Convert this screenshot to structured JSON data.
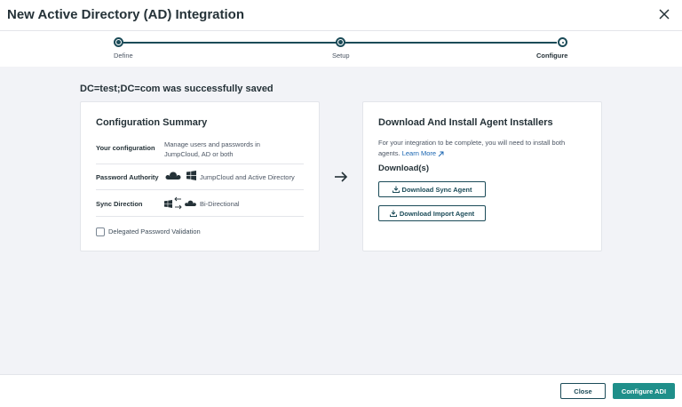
{
  "modal": {
    "title": "New Active Directory (AD) Integration"
  },
  "stepper": {
    "steps": [
      {
        "label": "Define",
        "state": "complete"
      },
      {
        "label": "Setup",
        "state": "complete"
      },
      {
        "label": "Configure",
        "state": "current"
      }
    ]
  },
  "saved_message": "DC=test;DC=com was successfully saved",
  "summary": {
    "title": "Configuration Summary",
    "rows": [
      {
        "label": "Your configuration",
        "value": "Manage users and passwords in JumpCloud, AD or both"
      },
      {
        "label": "Password Authority",
        "value": "JumpCloud and Active Directory",
        "icons": [
          "jumpcloud-icon",
          "windows-icon"
        ]
      },
      {
        "label": "Sync Direction",
        "value": "Bi-Directional",
        "icons": [
          "windows-icon",
          "bidirectional-arrows-icon",
          "jumpcloud-icon"
        ]
      }
    ],
    "checkbox_label": "Delegated Password Validation",
    "checkbox_checked": false
  },
  "installers": {
    "title": "Download And Install Agent Installers",
    "description": "For your integration to be complete, you will need to install both agents.",
    "learn_more": "Learn More",
    "download_heading": "Download(s)",
    "sync_button": "Download Sync Agent",
    "import_button": "Download Import Agent"
  },
  "footer": {
    "close_label": "Close",
    "configure_label": "Configure ADI"
  },
  "colors": {
    "primary": "#1f8f8a",
    "dark_teal": "#1b4b58",
    "background": "#f2f3f7",
    "link": "#1763b0"
  }
}
